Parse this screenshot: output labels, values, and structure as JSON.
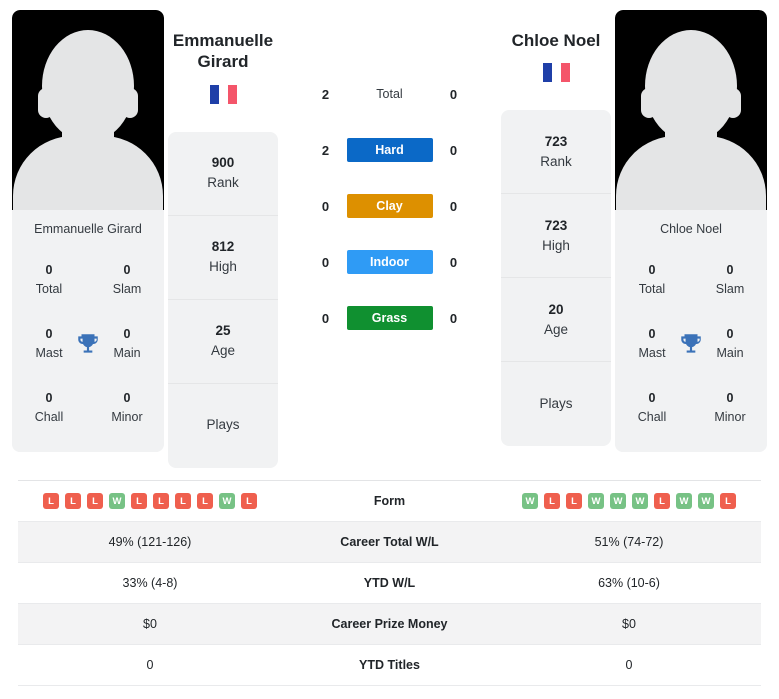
{
  "players": {
    "left": {
      "name": "Emmanuelle Girard",
      "name_display": "Emmanuelle Girard",
      "photo_caption": "Emmanuelle Girard",
      "flag": "fr",
      "rank": "900",
      "rank_label": "Rank",
      "high": "812",
      "high_label": "High",
      "age": "25",
      "age_label": "Age",
      "plays": "",
      "plays_label": "Plays",
      "titles": {
        "total": "0",
        "total_label": "Total",
        "slam": "0",
        "slam_label": "Slam",
        "mast": "0",
        "mast_label": "Mast",
        "main": "0",
        "main_label": "Main",
        "chall": "0",
        "chall_label": "Chall",
        "minor": "0",
        "minor_label": "Minor"
      },
      "form": [
        "L",
        "L",
        "L",
        "W",
        "L",
        "L",
        "L",
        "L",
        "W",
        "L"
      ],
      "career_wl": "49% (121-126)",
      "ytd_wl": "33% (4-8)",
      "career_prize": "$0",
      "ytd_titles": "0"
    },
    "right": {
      "name": "Chloe Noel",
      "name_display": "Chloe Noel",
      "photo_caption": "Chloe Noel",
      "flag": "fr",
      "rank": "723",
      "rank_label": "Rank",
      "high": "723",
      "high_label": "High",
      "age": "20",
      "age_label": "Age",
      "plays": "",
      "plays_label": "Plays",
      "titles": {
        "total": "0",
        "total_label": "Total",
        "slam": "0",
        "slam_label": "Slam",
        "mast": "0",
        "mast_label": "Mast",
        "main": "0",
        "main_label": "Main",
        "chall": "0",
        "chall_label": "Chall",
        "minor": "0",
        "minor_label": "Minor"
      },
      "form": [
        "W",
        "L",
        "L",
        "W",
        "W",
        "W",
        "L",
        "W",
        "W",
        "L"
      ],
      "career_wl": "51% (74-72)",
      "ytd_wl": "63% (10-6)",
      "career_prize": "$0",
      "ytd_titles": "0"
    }
  },
  "head_to_head": {
    "rows": [
      {
        "label": "Total",
        "left": "2",
        "right": "0",
        "color": "none",
        "plain": true
      },
      {
        "label": "Hard",
        "left": "2",
        "right": "0",
        "color": "#0b69c7",
        "plain": false
      },
      {
        "label": "Clay",
        "left": "0",
        "right": "0",
        "color": "#dd9000",
        "plain": false
      },
      {
        "label": "Indoor",
        "left": "0",
        "right": "0",
        "color": "#2f9bf5",
        "plain": false
      },
      {
        "label": "Grass",
        "left": "0",
        "right": "0",
        "color": "#109030",
        "plain": false
      }
    ]
  },
  "table": {
    "rows": [
      {
        "label": "Form",
        "type": "form"
      },
      {
        "label": "Career Total W/L",
        "type": "text",
        "left": "49% (121-126)",
        "right": "51% (74-72)"
      },
      {
        "label": "YTD W/L",
        "type": "text",
        "left": "33% (4-8)",
        "right": "63% (10-6)"
      },
      {
        "label": "Career Prize Money",
        "type": "text",
        "left": "$0",
        "right": "$0"
      },
      {
        "label": "YTD Titles",
        "type": "text",
        "left": "0",
        "right": "0"
      }
    ]
  },
  "colors": {
    "hard": "#0b69c7",
    "clay": "#dd9000",
    "indoor": "#2f9bf5",
    "grass": "#109030",
    "win": "#77c285",
    "loss": "#ef5f4e",
    "card_bg": "#f1f2f3"
  }
}
